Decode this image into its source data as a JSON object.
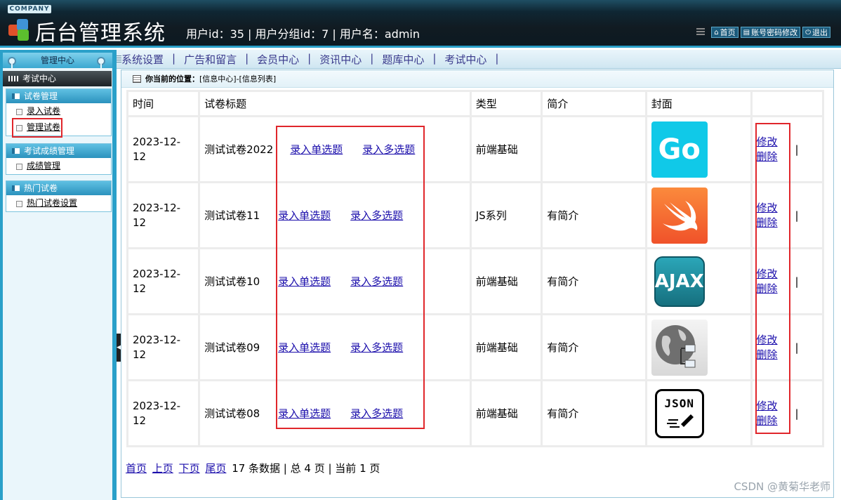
{
  "header": {
    "company": "COMPANY",
    "title": "后台管理系统",
    "user_info": "用户id：35 | 用户分组id：7 | 用户名：admin",
    "links": {
      "home": "首页",
      "password": "账号密码修改",
      "logout": "退出"
    }
  },
  "nav": {
    "items": [
      "系统设置",
      "广告和留言",
      "会员中心",
      "资讯中心",
      "题库中心",
      "考试中心"
    ]
  },
  "sidebar": {
    "header": "管理中心",
    "active": "考试中心",
    "groups": [
      {
        "title": "试卷管理",
        "items": [
          "录入试卷",
          "管理试卷"
        ]
      },
      {
        "title": "考试成绩管理",
        "items": [
          "成绩管理"
        ]
      },
      {
        "title": "热门试卷",
        "items": [
          "热门试卷设置"
        ]
      }
    ]
  },
  "breadcrumb": {
    "label": "你当前的位置：",
    "path": "[信息中心]-[信息列表]"
  },
  "table": {
    "headers": [
      "时间",
      "试卷标题",
      "类型",
      "简介",
      "封面",
      ""
    ],
    "single_label": "录入单选题",
    "multi_label": "录入多选题",
    "edit_label": "修改",
    "delete_label": "删除",
    "rows": [
      {
        "date_line1": "2023-12-",
        "date_line2": "12",
        "title": "测试试卷2022",
        "type": "前端基础",
        "intro": "",
        "cover": "Go"
      },
      {
        "date_line1": "2023-12-",
        "date_line2": "12",
        "title": "测试试卷11",
        "type": "JS系列",
        "intro": "有简介",
        "cover": "swift"
      },
      {
        "date_line1": "2023-12-",
        "date_line2": "12",
        "title": "测试试卷10",
        "type": "前端基础",
        "intro": "有简介",
        "cover": "AJAX"
      },
      {
        "date_line1": "2023-12-",
        "date_line2": "12",
        "title": "测试试卷09",
        "type": "前端基础",
        "intro": "有简介",
        "cover": "globe"
      },
      {
        "date_line1": "2023-12-",
        "date_line2": "12",
        "title": "测试试卷08",
        "type": "前端基础",
        "intro": "有简介",
        "cover": "JSON"
      }
    ]
  },
  "pager": {
    "first": "首页",
    "prev": "上页",
    "next": "下页",
    "last": "尾页",
    "info": "17 条数据 | 总 4 页 | 当前 1 页"
  },
  "watermark": "CSDN @黄菊华老师",
  "colors": {
    "highlight": "#e0262b",
    "link": "#1a0dab",
    "accent": "#2aa0c9"
  }
}
